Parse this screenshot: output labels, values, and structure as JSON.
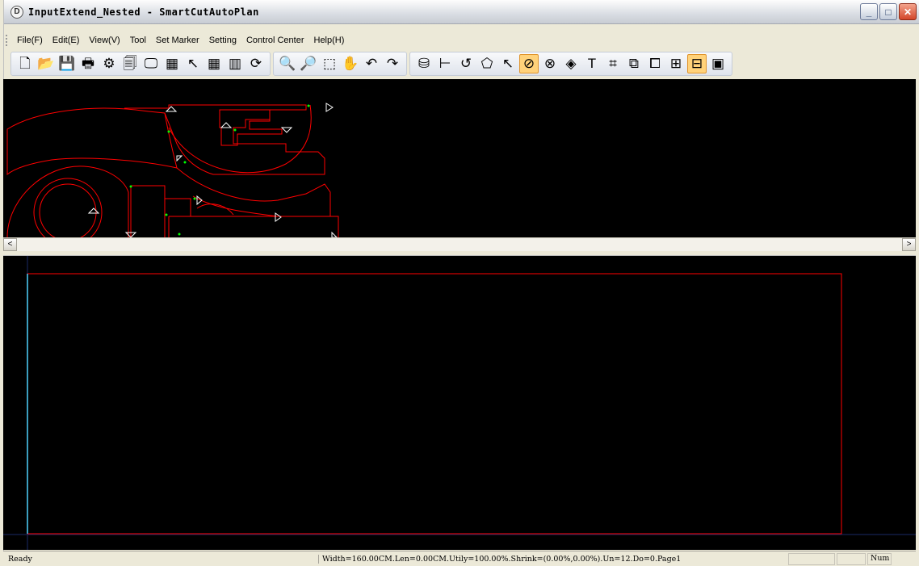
{
  "window": {
    "title": "InputExtend_Nested - SmartCutAutoPlan",
    "app_icon_glyph": "D",
    "buttons": {
      "minimize": "_",
      "maximize": "□",
      "close": "✕"
    }
  },
  "menu": [
    {
      "label": "File(F)"
    },
    {
      "label": "Edit(E)"
    },
    {
      "label": "View(V)"
    },
    {
      "label": "Tool"
    },
    {
      "label": "Set Marker"
    },
    {
      "label": "Setting"
    },
    {
      "label": "Control Center"
    },
    {
      "label": "Help(H)"
    }
  ],
  "toolbar": {
    "groups": [
      [
        {
          "icon": "new-file-icon",
          "glyph": "🗋"
        },
        {
          "icon": "open-folder-icon",
          "glyph": "📂"
        },
        {
          "icon": "save-icon",
          "glyph": "💾"
        },
        {
          "icon": "print-icon",
          "glyph": "🖶"
        },
        {
          "icon": "settings-gear-icon",
          "glyph": "⚙"
        },
        {
          "icon": "preview-icon",
          "glyph": "🗐"
        },
        {
          "icon": "monitor-icon",
          "glyph": "🖵"
        },
        {
          "icon": "calculator-icon",
          "glyph": "▦"
        },
        {
          "icon": "pointer-icon",
          "glyph": "↖"
        },
        {
          "icon": "grid-icon",
          "glyph": "▦"
        },
        {
          "icon": "columns-icon",
          "glyph": "▥"
        },
        {
          "icon": "refresh-icon",
          "glyph": "⟳"
        }
      ],
      [
        {
          "icon": "zoom-out-icon",
          "glyph": "🔍"
        },
        {
          "icon": "zoom-in-icon",
          "glyph": "🔎"
        },
        {
          "icon": "zoom-window-icon",
          "glyph": "⬚"
        },
        {
          "icon": "pan-hand-icon",
          "glyph": "✋"
        },
        {
          "icon": "undo-arrow-icon",
          "glyph": "↶"
        },
        {
          "icon": "redo-arrow-icon",
          "glyph": "↷"
        }
      ],
      [
        {
          "icon": "piece-icon",
          "glyph": "⛁"
        },
        {
          "icon": "measure-icon",
          "glyph": "⊢"
        },
        {
          "icon": "rotate-icon",
          "glyph": "↺"
        },
        {
          "icon": "shape-icon",
          "glyph": "⬠"
        },
        {
          "icon": "marker-pointer-icon",
          "glyph": "↖"
        },
        {
          "icon": "no-overlap-icon",
          "glyph": "⊘",
          "active": true
        },
        {
          "icon": "clear-icon",
          "glyph": "⊗"
        },
        {
          "icon": "fill-icon",
          "glyph": "◈"
        },
        {
          "icon": "text-icon",
          "glyph": "T"
        },
        {
          "icon": "hash-grid-icon",
          "glyph": "⌗"
        },
        {
          "icon": "resize-icon",
          "glyph": "⧉"
        },
        {
          "icon": "align-icon",
          "glyph": "⧠"
        },
        {
          "icon": "add-column-icon",
          "glyph": "⊞"
        },
        {
          "icon": "remove-column-icon",
          "glyph": "⊟",
          "active": true
        },
        {
          "icon": "report-icon",
          "glyph": "▣"
        }
      ]
    ]
  },
  "colors": {
    "canvas_bg": "#000000",
    "outline": "#ff0000",
    "node": "#00ff00",
    "marker": "#ffffff",
    "cursor_line": "#4fd2ff"
  },
  "statusbar": {
    "ready": "Ready",
    "info": "Width=160.00CM.Len=0.00CM.Utily=100.00%.Shrink=(0.00%,0.00%).Un=12.Do=0.Page1",
    "num": "Num"
  },
  "scroll": {
    "left_arrow": "<",
    "right_arrow": ">"
  }
}
